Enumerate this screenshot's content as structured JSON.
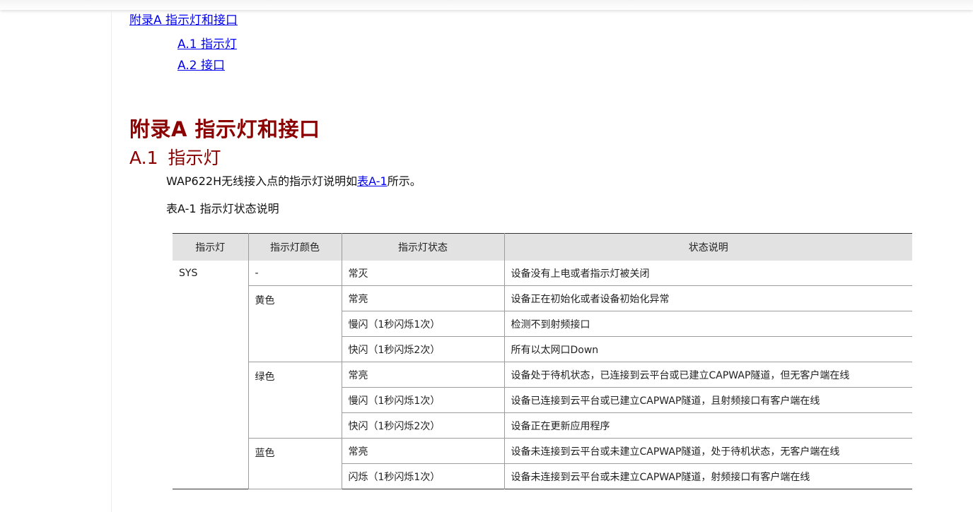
{
  "toc": {
    "main": "附录A 指示灯和接口",
    "items": [
      "A.1 指示灯",
      "A.2 接口"
    ]
  },
  "appendix_title": "附录A  指示灯和接口",
  "section": {
    "number": "A.1",
    "title": "指示灯"
  },
  "intro": {
    "before": "WAP622H无线接入点的指示灯说明如",
    "link": "表A-1",
    "after": "所示。"
  },
  "table_caption": "表A-1 指示灯状态说明",
  "table": {
    "headers": [
      "指示灯",
      "指示灯颜色",
      "指示灯状态",
      "状态说明"
    ],
    "indicator": "SYS",
    "groups": [
      {
        "color": "-",
        "rows": [
          {
            "state": "常灭",
            "desc": "设备没有上电或者指示灯被关闭"
          }
        ]
      },
      {
        "color": "黄色",
        "rows": [
          {
            "state": "常亮",
            "desc": "设备正在初始化或者设备初始化异常"
          },
          {
            "state": "慢闪（1秒闪烁1次）",
            "desc": "检测不到射频接口"
          },
          {
            "state": "快闪（1秒闪烁2次）",
            "desc": "所有以太网口Down"
          }
        ]
      },
      {
        "color": "绿色",
        "rows": [
          {
            "state": "常亮",
            "desc": "设备处于待机状态，已连接到云平台或已建立CAPWAP隧道，但无客户端在线"
          },
          {
            "state": "慢闪（1秒闪烁1次）",
            "desc": "设备已连接到云平台或已建立CAPWAP隧道，且射频接口有客户端在线"
          },
          {
            "state": "快闪（1秒闪烁2次）",
            "desc": "设备正在更新应用程序"
          }
        ]
      },
      {
        "color": "蓝色",
        "rows": [
          {
            "state": "常亮",
            "desc": "设备未连接到云平台或未建立CAPWAP隧道，处于待机状态，无客户端在线"
          },
          {
            "state": "闪烁（1秒闪烁1次）",
            "desc": "设备未连接到云平台或未建立CAPWAP隧道，射频接口有客户端在线"
          }
        ]
      }
    ]
  }
}
